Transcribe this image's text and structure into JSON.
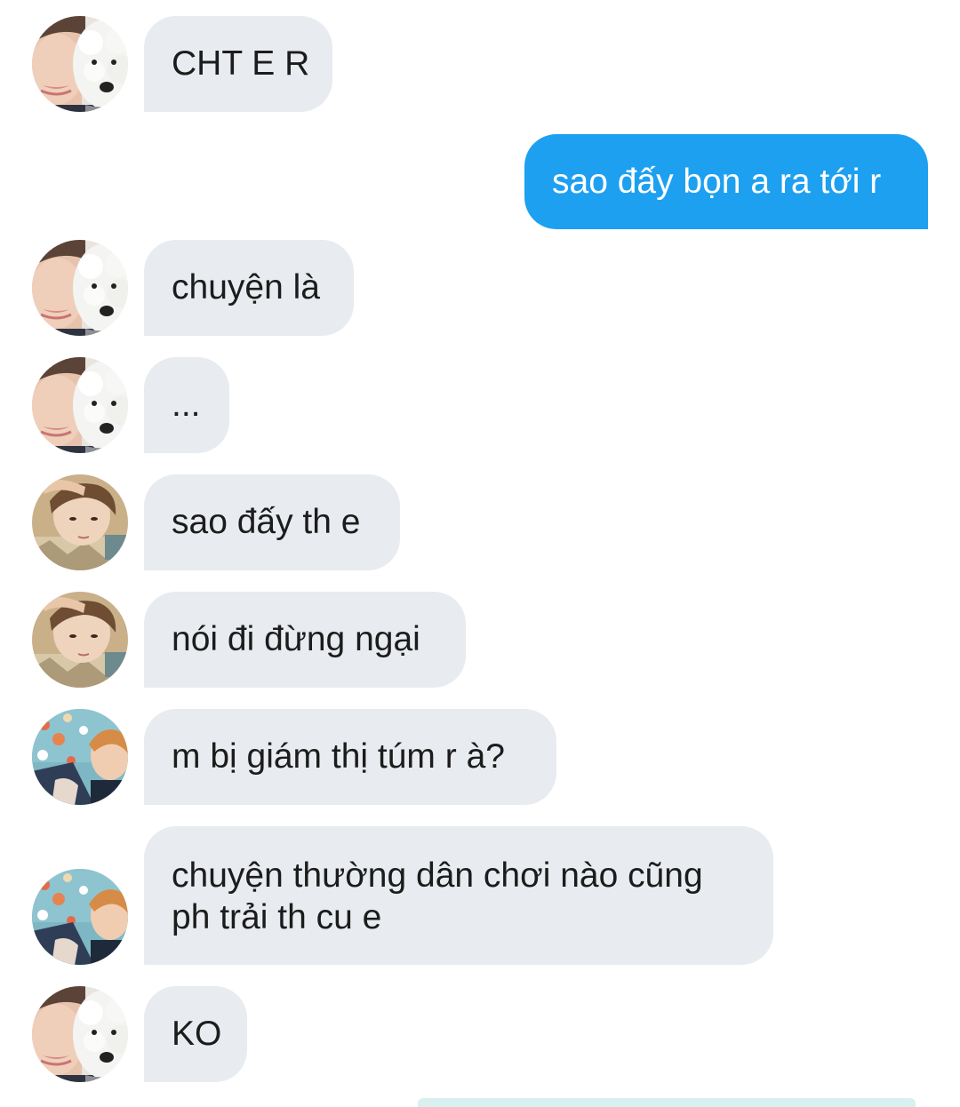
{
  "messages": [
    {
      "sender": "friend",
      "avatar": "girl-with-dog",
      "text": "CHT E R"
    },
    {
      "sender": "me",
      "text": "sao đấy bọn a ra tới r"
    },
    {
      "sender": "friend",
      "avatar": "girl-with-dog",
      "text": "chuyện là"
    },
    {
      "sender": "friend",
      "avatar": "girl-with-dog",
      "text": "..."
    },
    {
      "sender": "friend",
      "avatar": "boy-hand-on-head",
      "text": "sao đấy th e"
    },
    {
      "sender": "friend",
      "avatar": "boy-hand-on-head",
      "text": "nói đi đừng ngại"
    },
    {
      "sender": "friend",
      "avatar": "boy-blue-pattern",
      "text": "m bị giám thị túm r à?"
    },
    {
      "sender": "friend",
      "avatar": "boy-blue-pattern",
      "text": "chuyện thường dân chơi nào cũng ph trải th cu e"
    },
    {
      "sender": "friend",
      "avatar": "girl-with-dog",
      "text": "KO"
    }
  ],
  "colors": {
    "incoming_bubble": "#e8ebef",
    "outgoing_bubble": "#1ea0f1",
    "incoming_text": "#1c1c1c",
    "outgoing_text": "#ffffff"
  }
}
